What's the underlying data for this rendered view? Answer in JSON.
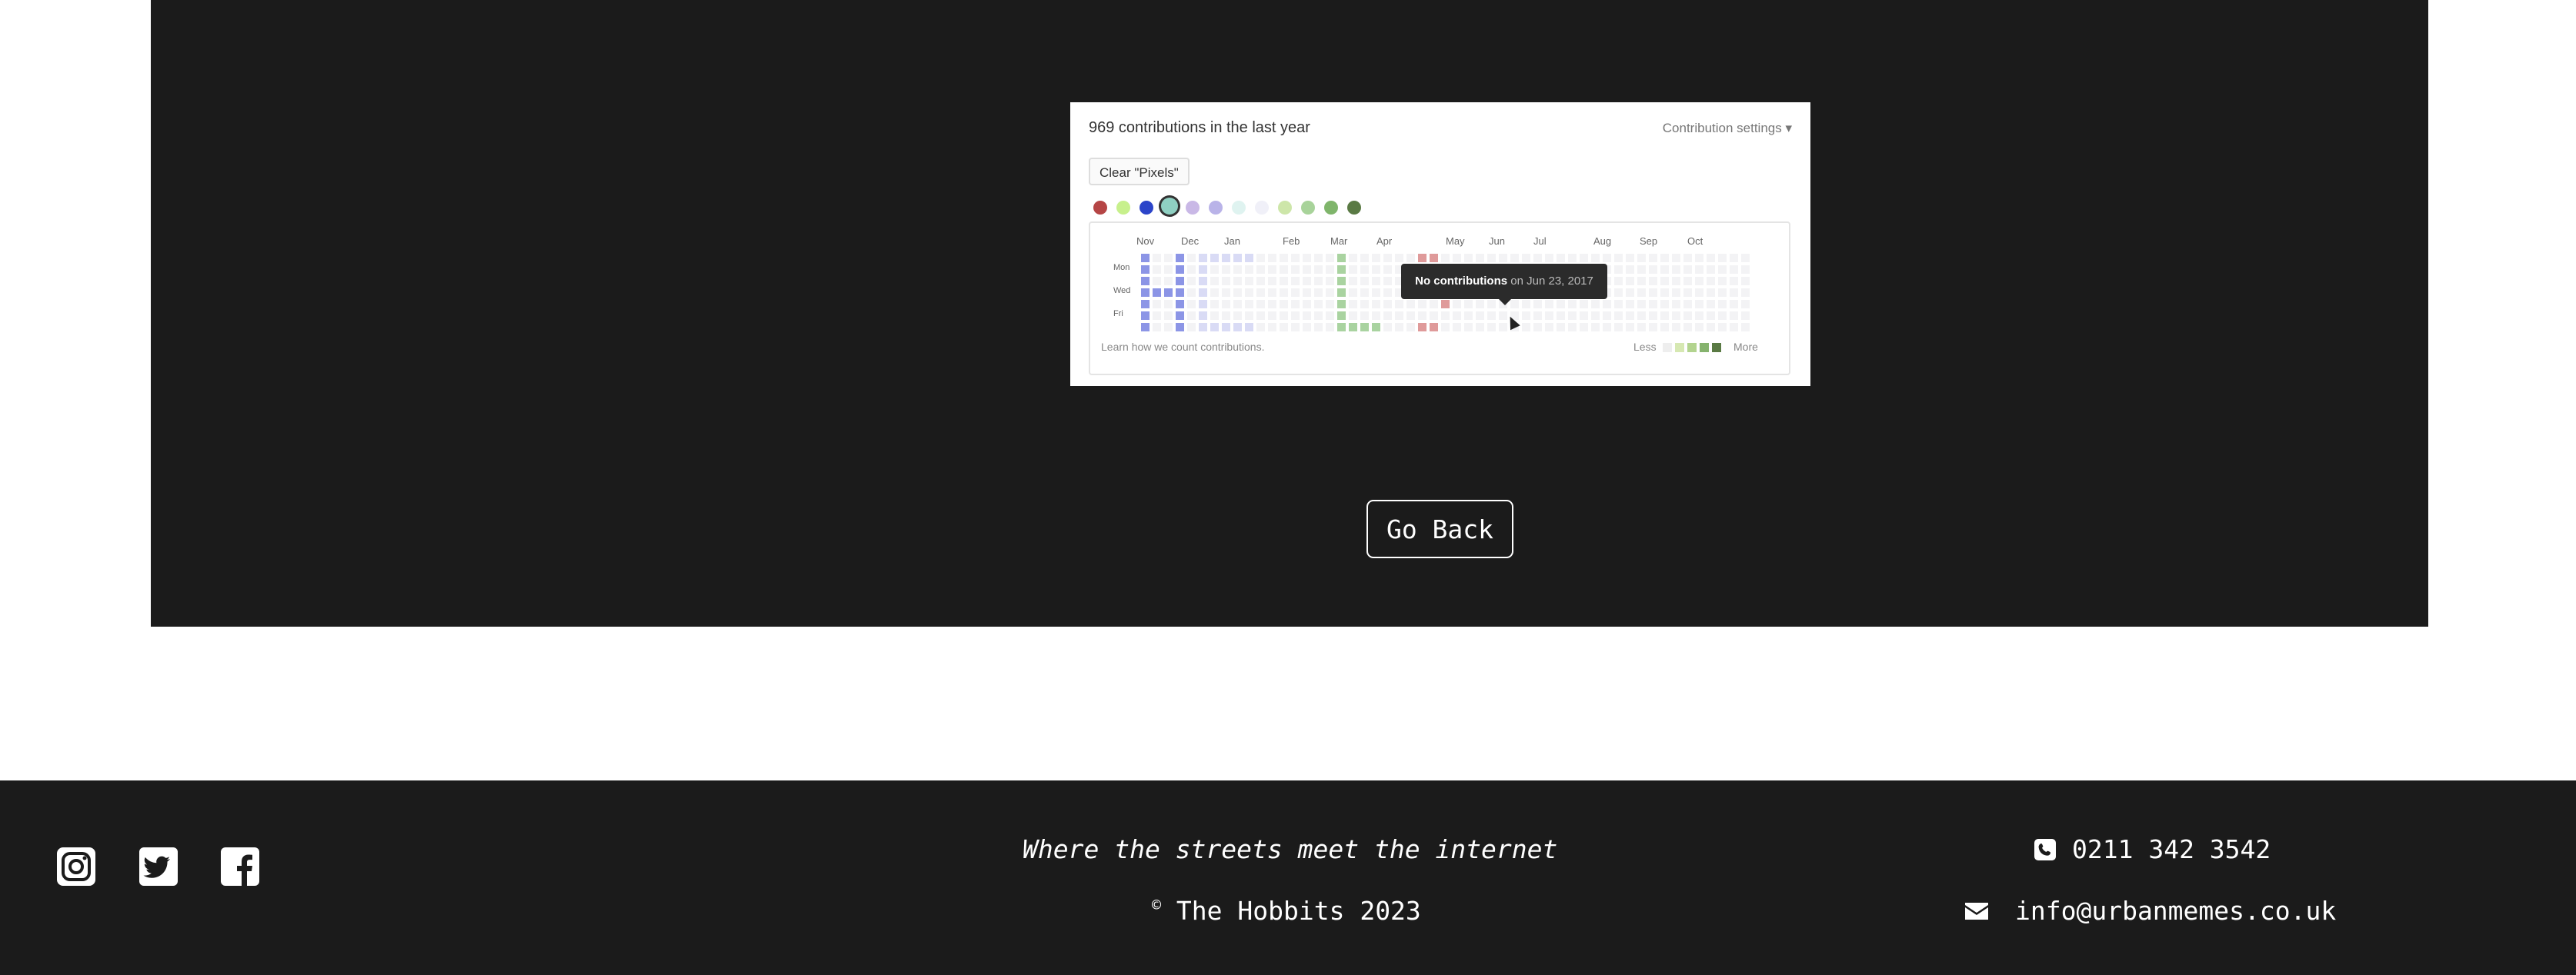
{
  "screenshot": {
    "heading": "969 contributions in the last year",
    "settings_label": "Contribution settings ▾",
    "clear_button": "Clear \"Pixels\"",
    "palette_colors": [
      "#b54545",
      "#c7f08c",
      "#2b44c9",
      "#8fd0c2",
      "#c9b8e6",
      "#b9b3e8",
      "#dff3f0",
      "#f0f0f8",
      "#cde6a9",
      "#a8d39a",
      "#7fb56b",
      "#5a7a44"
    ],
    "months": [
      "Nov",
      "Dec",
      "Jan",
      "Feb",
      "Mar",
      "Apr",
      "May",
      "Jun",
      "Jul",
      "Aug",
      "Sep",
      "Oct"
    ],
    "days": [
      "Mon",
      "Wed",
      "Fri"
    ],
    "tooltip_bold": "No contributions",
    "tooltip_rest": " on Jun 23, 2017",
    "learn_link": "Learn how we count contributions.",
    "legend_less": "Less",
    "legend_more": "More",
    "legend_colors": [
      "#eeeeee",
      "#d6e8b2",
      "#b3d48f",
      "#86b36e",
      "#5a7a44"
    ]
  },
  "actions": {
    "go_back": "Go Back"
  },
  "footer": {
    "social_icons": [
      "instagram-icon",
      "twitter-icon",
      "facebook-icon"
    ],
    "tagline": "Where the streets meet the internet",
    "copyright_symbol": "©",
    "copyright_text": " The Hobbits 2023",
    "phone": "0211 342 3542",
    "email": "info@urbanmemes.co.uk"
  }
}
